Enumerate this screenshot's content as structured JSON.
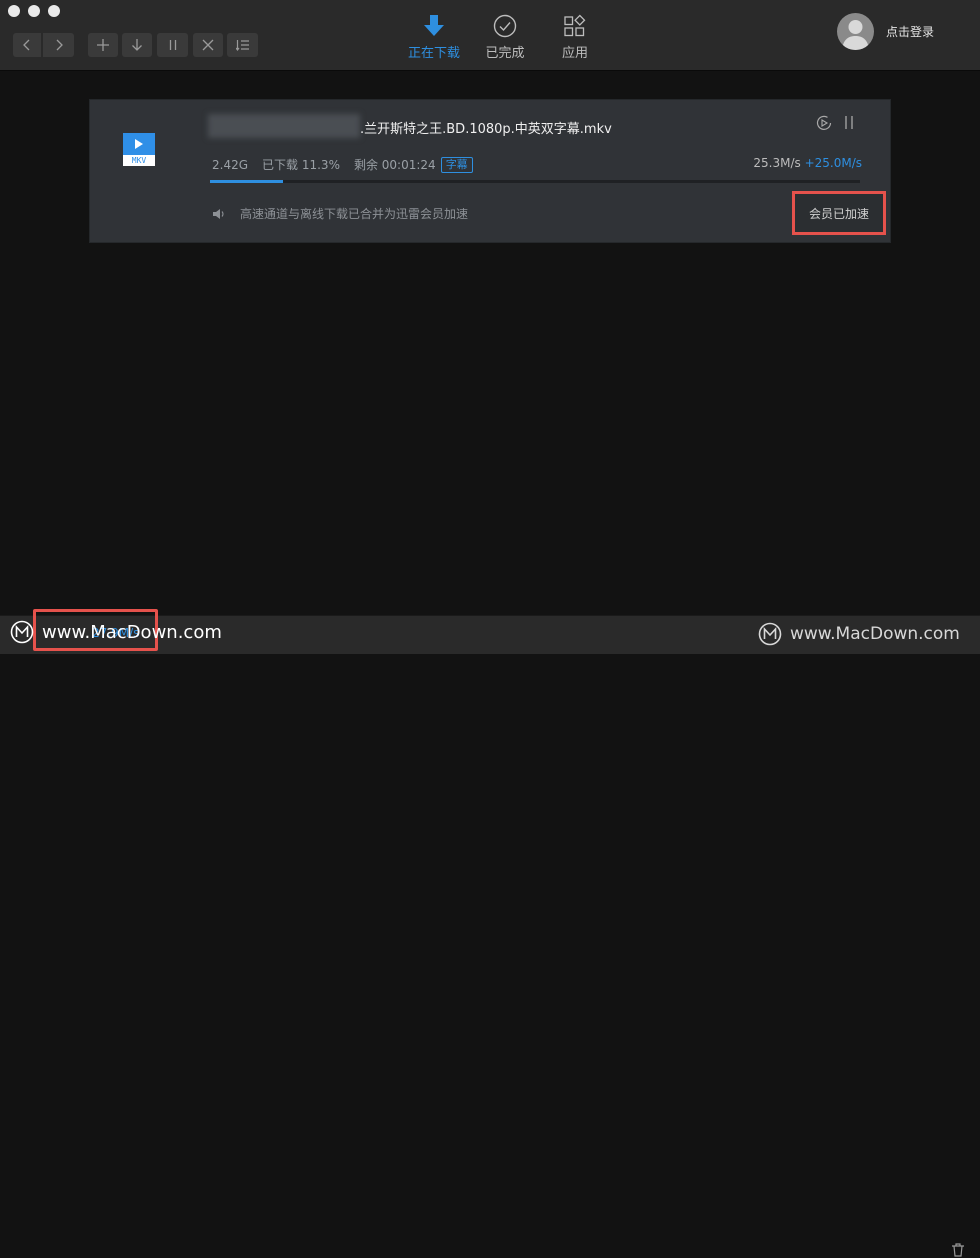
{
  "toolbar": {
    "tabs": [
      {
        "label": "正在下载",
        "icon": "download-arrow-icon",
        "active": true
      },
      {
        "label": "已完成",
        "icon": "check-circle-icon",
        "active": false
      },
      {
        "label": "应用",
        "icon": "apps-grid-icon",
        "active": false
      }
    ],
    "buttons": [
      "back-icon",
      "forward-icon",
      "plus-icon",
      "download-icon",
      "pause-icon",
      "close-icon",
      "list-icon"
    ],
    "login_label": "点击登录"
  },
  "task": {
    "file_ext": "MKV",
    "filename_visible": ".兰开斯特之王.BD.1080p.中英双字幕.mkv",
    "size": "2.42G",
    "downloaded": "已下载 11.3%",
    "remaining": "剩余 00:01:24",
    "subtitle_badge": "字幕",
    "speed": "25.3M/s",
    "boost_speed": "+25.0M/s",
    "progress_percent": 11.3,
    "notice": "高速通道与离线下载已合并为迅雷会员加速",
    "vip_status": "会员已加速"
  },
  "statusbar": {
    "speed": "27.9M/s"
  },
  "watermark": {
    "left": "www.MacDown.com",
    "right": "www.MacDown.com"
  },
  "colors": {
    "accent": "#2e8fe0",
    "highlight": "#e5524c",
    "background": "#121212"
  }
}
